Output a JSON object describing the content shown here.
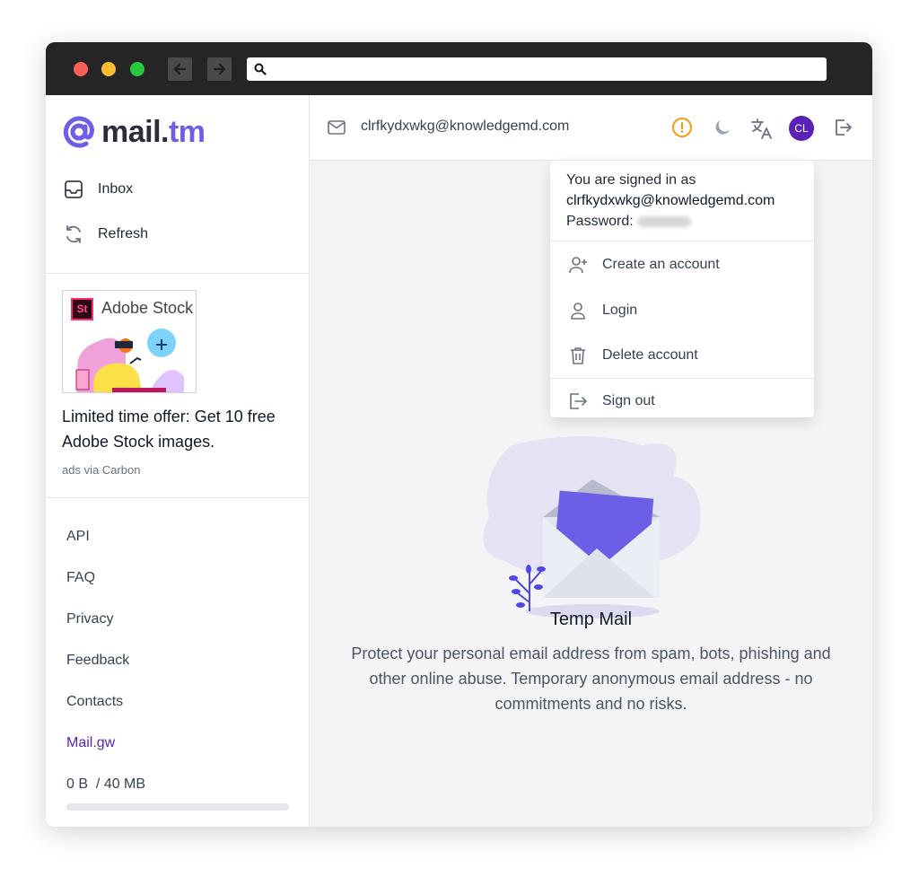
{
  "browser": {
    "dot_colors": [
      "#ff5f57",
      "#febc2e",
      "#28c840"
    ],
    "back_icon": "arrow-left-icon",
    "forward_icon": "arrow-right-icon",
    "search_icon": "search-icon"
  },
  "sidebar": {
    "logo": {
      "at": "@",
      "brand": "mail.",
      "tld": "tm"
    },
    "nav": [
      {
        "label": "Inbox",
        "icon": "inbox-icon"
      },
      {
        "label": "Refresh",
        "icon": "refresh-icon"
      }
    ],
    "ad": {
      "brand": "Adobe Stock",
      "badge": "St",
      "text": "Limited time offer: Get 10 free Adobe Stock images.",
      "via": "ads via Carbon"
    },
    "links": [
      "API",
      "FAQ",
      "Privacy",
      "Feedback",
      "Contacts",
      "Mail.gw"
    ],
    "storage": {
      "used": "0 B",
      "separator": "/",
      "total": "40 MB",
      "fraction": 0
    }
  },
  "topbar": {
    "email": "clrfkydxwkg@knowledgemd.com",
    "avatar": "CL",
    "colors": {
      "warning": "#f59e0b",
      "avatar": "#5b21b6",
      "accent": "#6d5ee8"
    }
  },
  "dropdown": {
    "signed_in_label": "You are signed in as",
    "email": "clrfkydxwkg@knowledgemd.com",
    "password_label": "Password:",
    "items": [
      {
        "label": "Create an account",
        "icon": "user-plus-icon"
      },
      {
        "label": "Login",
        "icon": "user-icon"
      },
      {
        "label": "Delete account",
        "icon": "trash-icon"
      },
      {
        "label": "Sign out",
        "icon": "sign-out-icon"
      }
    ]
  },
  "hero": {
    "title": "Temp Mail",
    "description": "Protect your personal email address from spam, bots, phishing and other online abuse. Temporary anonymous email address - no commitments and no risks."
  }
}
